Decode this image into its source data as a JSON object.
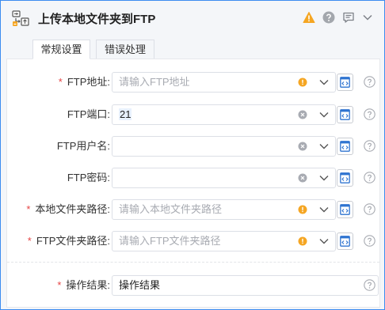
{
  "header": {
    "title": "上传本地文件夹到FTP",
    "icons": [
      "warning-icon",
      "help-icon",
      "comment-icon",
      "collapse-icon"
    ]
  },
  "tabs": [
    {
      "label": "常规设置",
      "active": true
    },
    {
      "label": "错误处理",
      "active": false
    }
  ],
  "fields": [
    {
      "label": "FTP地址:",
      "required": true,
      "value": "",
      "placeholder": "请输入FTP地址",
      "status": "warning"
    },
    {
      "label": "FTP端口:",
      "required": false,
      "value": "21",
      "placeholder": "",
      "status": "clear"
    },
    {
      "label": "FTP用户名:",
      "required": false,
      "value": "",
      "placeholder": "",
      "status": "clear"
    },
    {
      "label": "FTP密码:",
      "required": false,
      "value": "",
      "placeholder": "",
      "status": "clear"
    },
    {
      "label": "本地文件夹路径:",
      "required": true,
      "value": "",
      "placeholder": "请输入本地文件夹路径",
      "status": "warning"
    },
    {
      "label": "FTP文件夹路径:",
      "required": true,
      "value": "",
      "placeholder": "请输入FTP文件夹路径",
      "status": "warning"
    }
  ],
  "output": {
    "label": "操作结果:",
    "required": true,
    "value": "操作结果"
  },
  "colors": {
    "accent": "#3c8cf0",
    "warning": "#f5a623",
    "required": "#e64545"
  }
}
